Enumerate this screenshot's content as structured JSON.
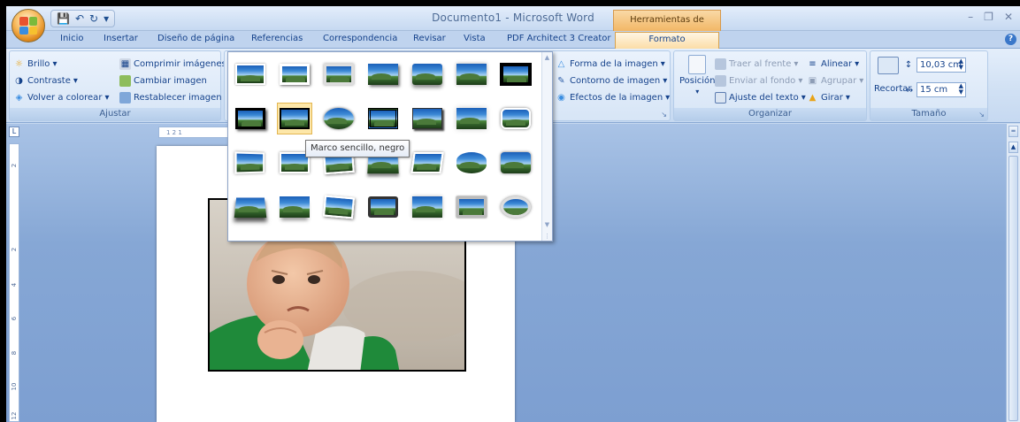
{
  "app": {
    "window_title": "Documento1 - Microsoft Word",
    "context_tab_title": "Herramientas de imagen"
  },
  "tabs": [
    {
      "label": "Inicio"
    },
    {
      "label": "Insertar"
    },
    {
      "label": "Diseño de página"
    },
    {
      "label": "Referencias"
    },
    {
      "label": "Correspondencia"
    },
    {
      "label": "Revisar"
    },
    {
      "label": "Vista"
    },
    {
      "label": "PDF Architect 3 Creator"
    },
    {
      "label": "Formato",
      "active": true
    }
  ],
  "ribbon": {
    "ajustar": {
      "label": "Ajustar",
      "brillo": "Brillo",
      "contraste": "Contraste",
      "volver_colorear": "Volver a colorear",
      "comprimir": "Comprimir imágenes",
      "cambiar": "Cambiar imagen",
      "restablecer": "Restablecer imagen"
    },
    "estilos": {
      "forma": "Forma de la imagen",
      "contorno": "Contorno de imagen",
      "efectos": "Efectos de la imagen"
    },
    "organizar": {
      "label": "Organizar",
      "posicion": "Posición",
      "traer": "Traer al frente",
      "enviar": "Enviar al fondo",
      "ajuste": "Ajuste del texto",
      "alinear": "Alinear",
      "agrupar": "Agrupar",
      "girar": "Girar"
    },
    "tamano": {
      "label": "Tamaño",
      "recortar": "Recortar",
      "height": "10,03 cm",
      "width": "15 cm"
    }
  },
  "gallery": {
    "tooltip": "Marco sencillo, negro",
    "hovered_index": 8
  },
  "rulers": {
    "horizontal": "1  2  1",
    "vertical_numbers": [
      "2",
      "2",
      "4",
      "6",
      "8",
      "10",
      "12"
    ]
  }
}
